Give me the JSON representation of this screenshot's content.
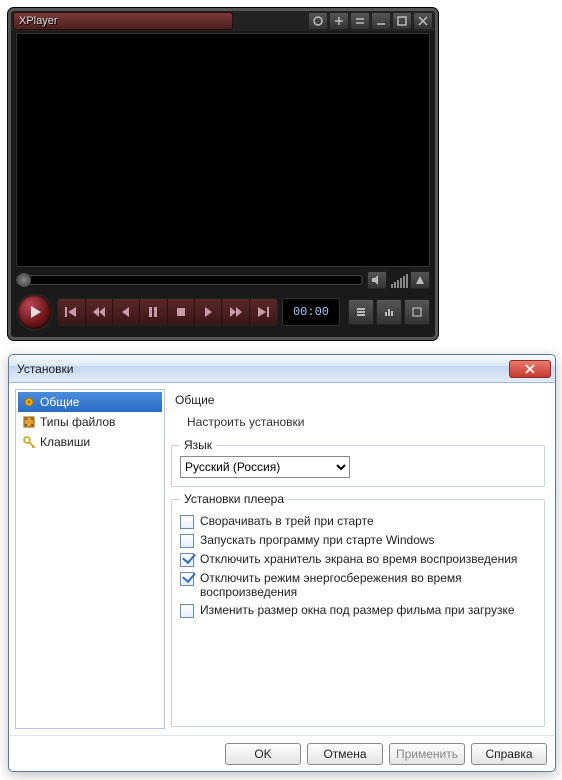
{
  "player": {
    "title": "XPlayer",
    "time": "00:00"
  },
  "dialog": {
    "title": "Установки",
    "nav": {
      "general": "Общие",
      "filetypes": "Типы файлов",
      "keys": "Клавиши"
    },
    "section_title": "Общие",
    "section_desc": "Настроить установки",
    "lang_group": "Язык",
    "lang_value": "Русский (Россия)",
    "player_group": "Установки плеера",
    "chk": {
      "min_tray": "Сворачивать в трей при старте",
      "autostart": "Запускать программу при старте Windows",
      "no_screensaver": "Отключить хранитель экрана во время воспроизведения",
      "no_powersave": "Отключить режим энергосбережения во время воспроизведения",
      "resize_to_movie": "Изменить размер окна под размер фильма при загрузке"
    },
    "buttons": {
      "ok": "OK",
      "cancel": "Отмена",
      "apply": "Применить",
      "help": "Справка"
    }
  }
}
